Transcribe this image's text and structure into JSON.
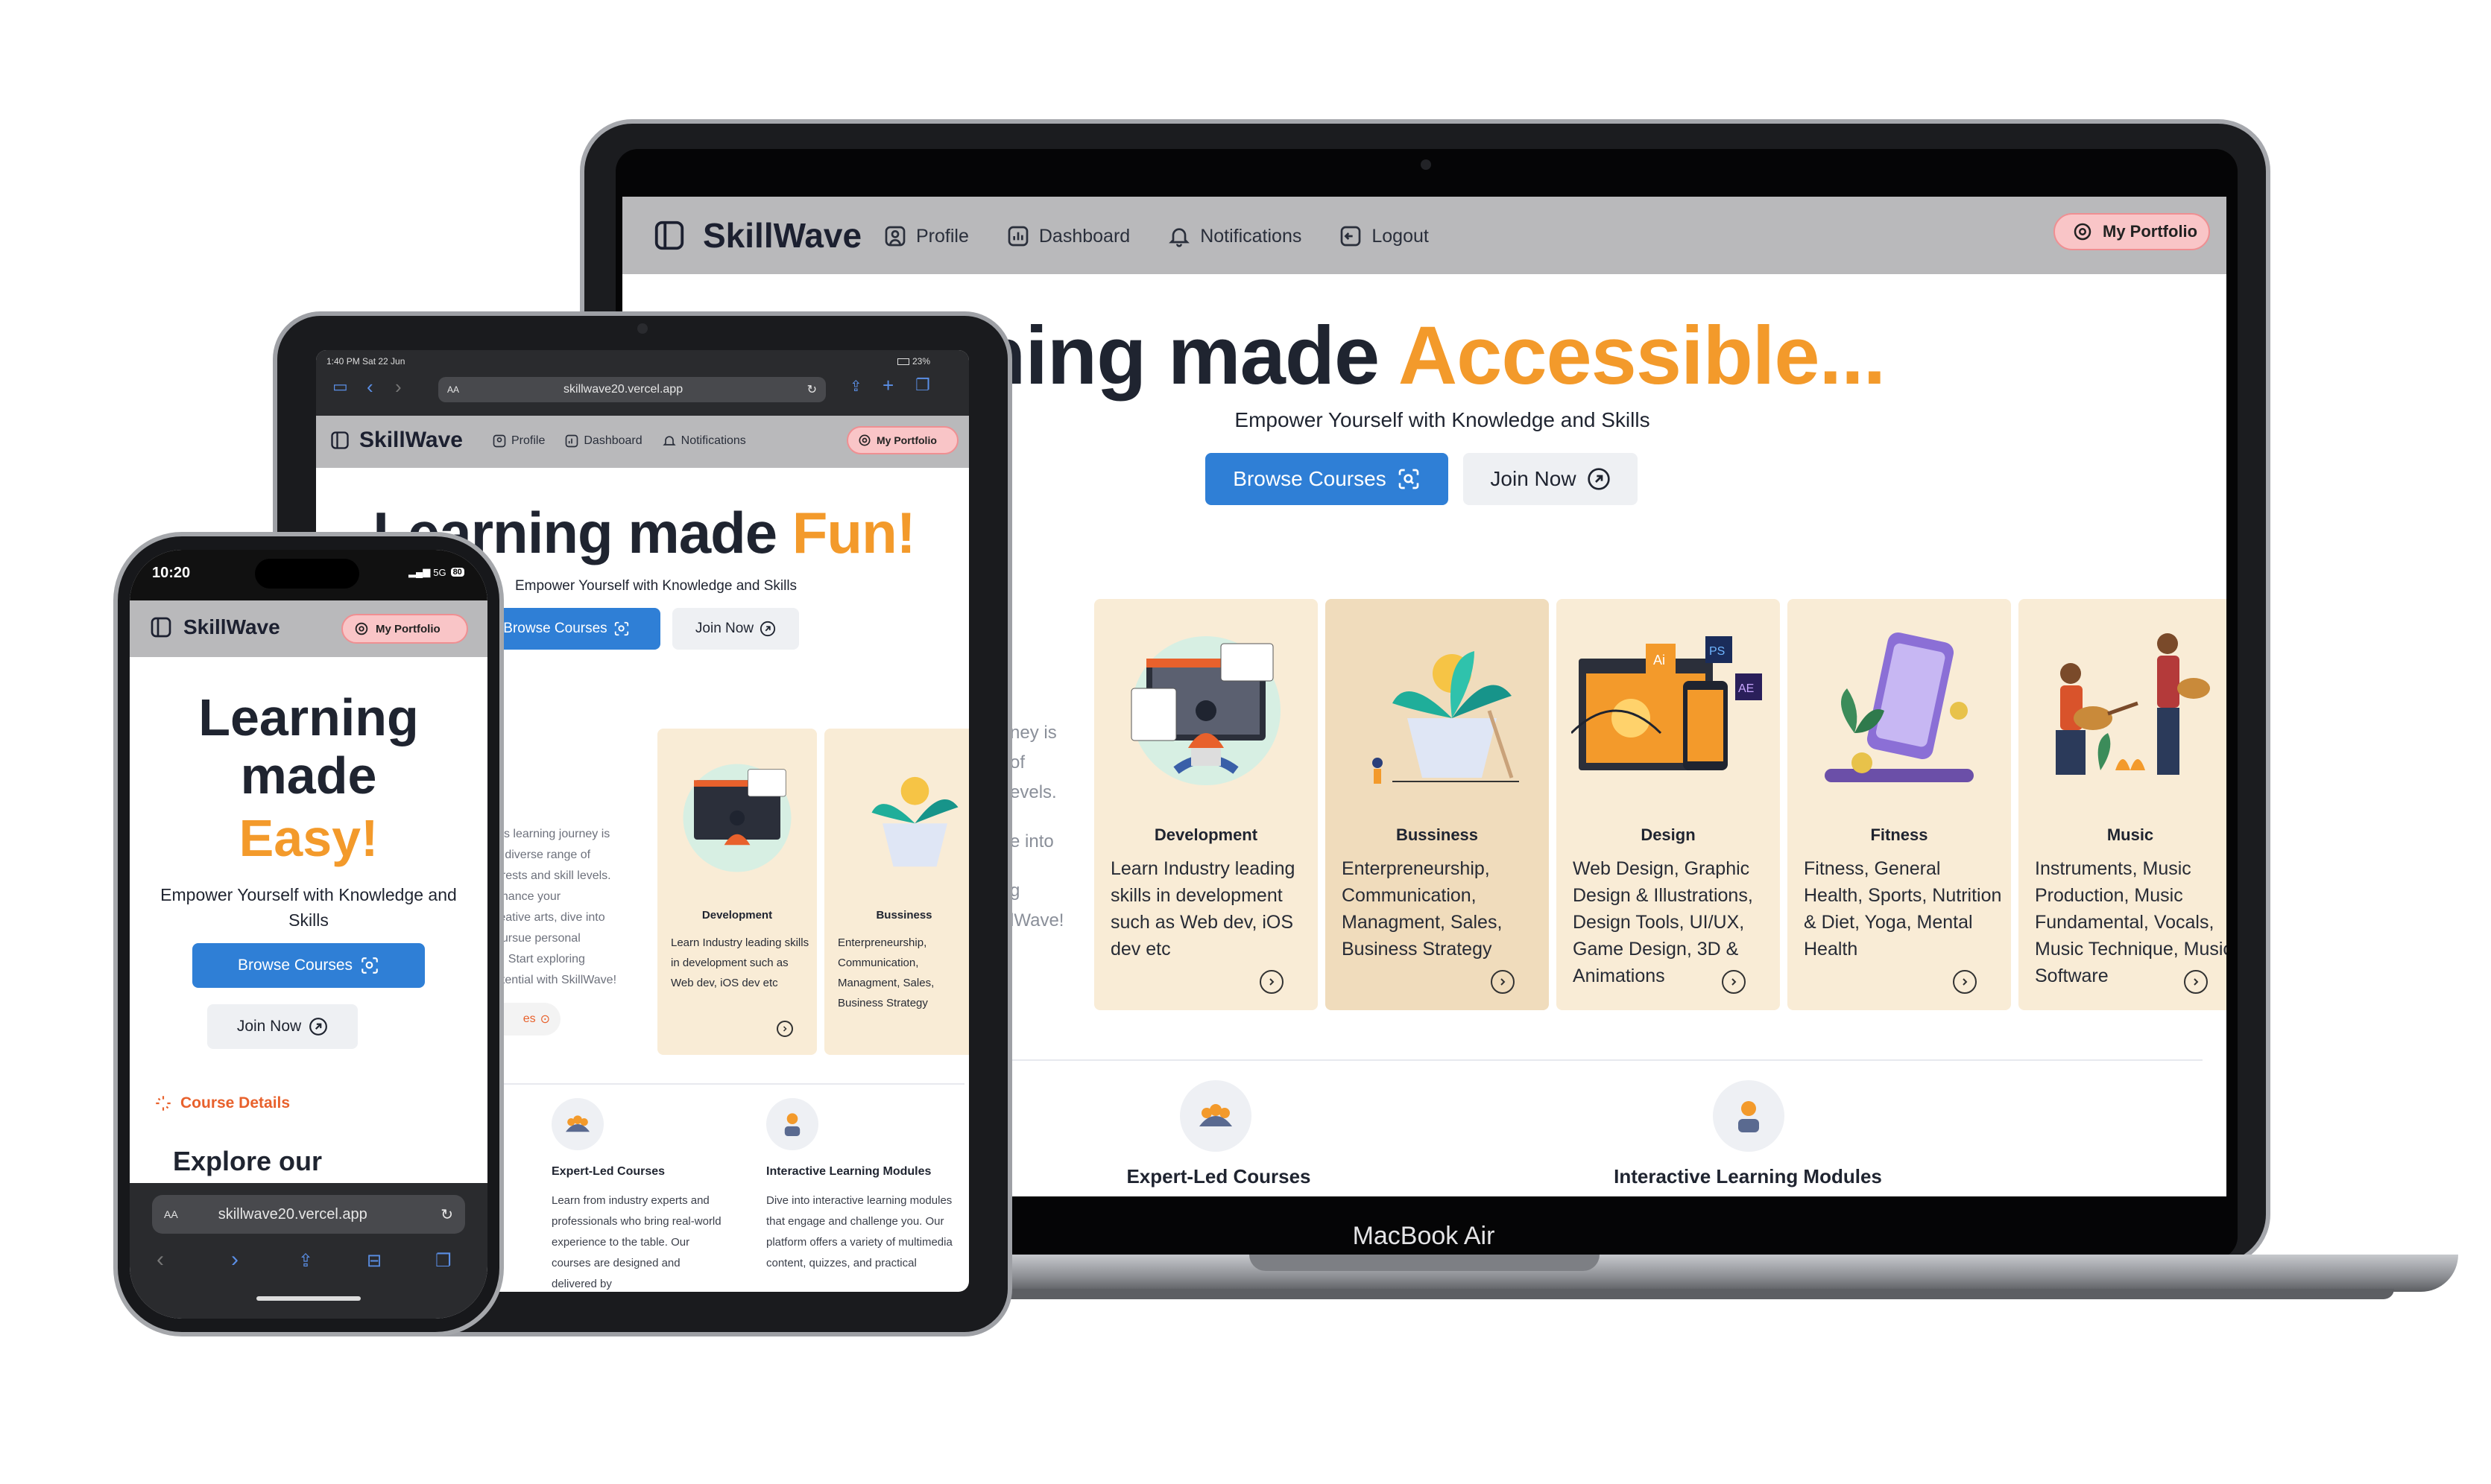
{
  "brand": "SkillWave",
  "nav": {
    "profile": "Profile",
    "dashboard": "Dashboard",
    "notifications": "Notifications",
    "logout": "Logout",
    "portfolio": "My Portfolio"
  },
  "hero": {
    "title_prefix_laptop": "Learning made",
    "accent_laptop": "Accessible...",
    "title_prefix_tablet": "Learning made",
    "accent_tablet": "Fun!",
    "phone_line1": "Learning",
    "phone_line2": "made",
    "accent_phone": "Easy!",
    "subtitle": "Empower Yourself with Knowledge and Skills",
    "browse": "Browse Courses",
    "join": "Join Now"
  },
  "categories": [
    {
      "title": "Development",
      "desc": "Learn Industry leading skills in development such as Web dev, iOS dev etc"
    },
    {
      "title": "Bussiness",
      "desc": "Enterpreneurship, Communication, Managment, Sales, Business Strategy"
    },
    {
      "title": "Design",
      "desc": "Web Design, Graphic Design & Illustrations, Design Tools, UI/UX, Game Design, 3D & Animations"
    },
    {
      "title": "Fitness",
      "desc": "Fitness, General Health, Sports, Nutrition & Diet, Yoga, Mental Health"
    },
    {
      "title": "Music",
      "desc": "Instruments, Music Production, Music Fundamental, Vocals, Music Technique, Music Software"
    }
  ],
  "laptop": {
    "side_text": [
      "ney is",
      "of",
      "evels.",
      "e into",
      "g",
      "lWave!"
    ],
    "label": "MacBook Air"
  },
  "features": {
    "expert_title": "Expert-Led Courses",
    "expert_desc": "Learn from industry experts and professionals who bring real-world experience to the table. Our courses are designed and delivered by",
    "interactive_title": "Interactive Learning Modules",
    "interactive_desc": "Dive into interactive learning modules that engage and challenge you. Our platform offers a variety of multimedia content, quizzes, and practical",
    "tablet_left_cut": [
      "s",
      "h",
      "h",
      "e."
    ]
  },
  "tablet": {
    "status_time": "1:40 PM  Sat 22 Jun",
    "status_right": "23%",
    "url": "skillwave20.vercel.app",
    "aa": "AA",
    "side_text": [
      "e's learning journey is",
      "a diverse range of",
      "erests and skill levels.",
      "nhance your",
      "reative arts, dive into",
      "pursue personal",
      "e. Start exploring",
      "otential with SkillWave!"
    ],
    "side_button": "es"
  },
  "phone": {
    "time": "10:20",
    "network": "5G",
    "battery": "80",
    "course_details": "Course Details",
    "explore": "Explore our",
    "url": "skillwave20.vercel.app",
    "aa": "AA"
  },
  "colors": {
    "accent": "#f39a2b",
    "primary": "#2f7fd6",
    "card": "#f9ecd6",
    "pill": "#f9c5c7"
  }
}
